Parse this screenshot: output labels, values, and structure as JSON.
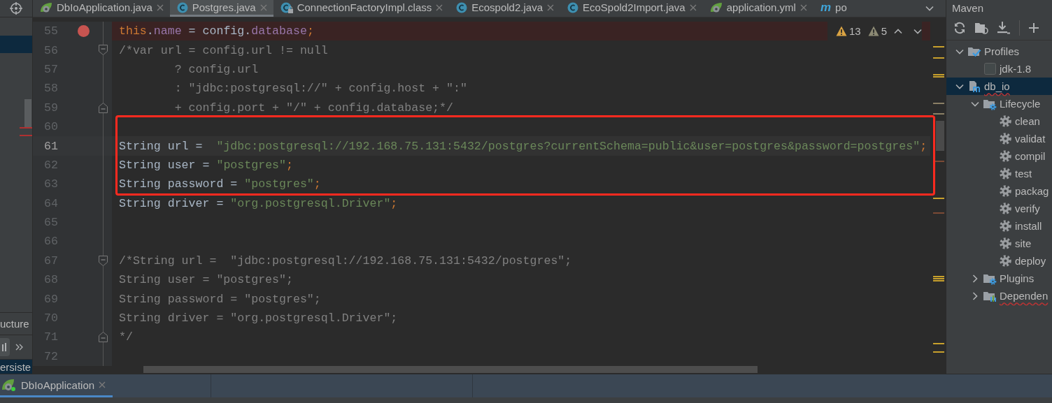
{
  "left_panel": {
    "tab": "ucture",
    "row": {
      "label": "ersiste",
      "selected": true
    }
  },
  "editor_tabs": [
    {
      "label": "DbIoApplication.java",
      "kind": "spring",
      "selected": false,
      "closable": true
    },
    {
      "label": "Postgres.java",
      "kind": "class",
      "selected": true,
      "closable": true
    },
    {
      "label": "ConnectionFactoryImpl.class",
      "kind": "locked_class",
      "selected": false,
      "closable": true
    },
    {
      "label": "Ecospold2.java",
      "kind": "class",
      "selected": false,
      "closable": true
    },
    {
      "label": "EcoSpold2Import.java",
      "kind": "class",
      "selected": false,
      "closable": true
    },
    {
      "label": "application.yml",
      "kind": "spring",
      "selected": false,
      "closable": true
    },
    {
      "label": "po",
      "kind": "letter",
      "glyph": "m",
      "selected": false,
      "closable": false
    }
  ],
  "inspections": [
    {
      "kind": "warning",
      "count": "13"
    },
    {
      "kind": "weak_warning",
      "count": "5"
    }
  ],
  "code_lines": [
    {
      "number": "55",
      "breakpoint": true,
      "current": false,
      "framed": false,
      "tokens": [
        {
          "kind": "keyword",
          "text": "this"
        },
        {
          "kind": "plain",
          "text": "."
        },
        {
          "kind": "field",
          "text": "name"
        },
        {
          "kind": "plain",
          "text": " = config."
        },
        {
          "kind": "field",
          "text": "database"
        },
        {
          "kind": "keyword",
          "text": ";"
        }
      ]
    },
    {
      "number": "56",
      "breakpoint": false,
      "current": false,
      "framed": false,
      "kind": "fold_start",
      "tokens": [
        {
          "kind": "comment",
          "text": "/*var url = config.url != null"
        }
      ]
    },
    {
      "number": "57",
      "breakpoint": false,
      "current": false,
      "framed": false,
      "tokens": [
        {
          "kind": "comment",
          "text": "        ? config.url"
        }
      ]
    },
    {
      "number": "58",
      "breakpoint": false,
      "current": false,
      "framed": false,
      "tokens": [
        {
          "kind": "comment",
          "text": "        : \"jdbc:postgresql://\" + config.host + \":\""
        }
      ]
    },
    {
      "number": "59",
      "breakpoint": false,
      "current": false,
      "framed": false,
      "kind": "fold_end",
      "tokens": [
        {
          "kind": "comment",
          "text": "        + config.port + \"/\" + config.database;*/"
        }
      ]
    },
    {
      "number": "60",
      "breakpoint": false,
      "current": false,
      "framed": true
    },
    {
      "number": "61",
      "breakpoint": false,
      "current": true,
      "framed": true,
      "tokens": [
        {
          "kind": "plain",
          "text": "String url =  "
        },
        {
          "kind": "string",
          "text": "\"jdbc:postgresql://192.168.75.131:5432/postgres?currentSchema=public&user=postgres&password=postgres\""
        },
        {
          "kind": "keyword",
          "text": ";"
        }
      ]
    },
    {
      "number": "62",
      "breakpoint": false,
      "current": false,
      "framed": true,
      "tokens": [
        {
          "kind": "plain",
          "text": "String user = "
        },
        {
          "kind": "string",
          "text": "\"postgres\""
        },
        {
          "kind": "keyword",
          "text": ";"
        }
      ]
    },
    {
      "number": "63",
      "breakpoint": false,
      "current": false,
      "framed": true,
      "tokens": [
        {
          "kind": "plain",
          "text": "String password = "
        },
        {
          "kind": "string",
          "text": "\"postgres\""
        },
        {
          "kind": "keyword",
          "text": ";"
        }
      ]
    },
    {
      "number": "64",
      "breakpoint": false,
      "current": false,
      "framed": false,
      "tokens": [
        {
          "kind": "plain",
          "text": "String driver = "
        },
        {
          "kind": "string",
          "text": "\"org.postgresql.Driver\""
        },
        {
          "kind": "keyword",
          "text": ";"
        }
      ]
    },
    {
      "number": "65",
      "breakpoint": false,
      "current": false,
      "framed": false
    },
    {
      "number": "66",
      "breakpoint": false,
      "current": false,
      "framed": false
    },
    {
      "number": "67",
      "breakpoint": false,
      "current": false,
      "framed": false,
      "kind": "fold_start",
      "tokens": [
        {
          "kind": "comment",
          "text": "/*String url =  \"jdbc:postgresql://192.168.75.131:5432/postgres\";"
        }
      ]
    },
    {
      "number": "68",
      "breakpoint": false,
      "current": false,
      "framed": false,
      "tokens": [
        {
          "kind": "comment",
          "text": "String user = \"postgres\";"
        }
      ]
    },
    {
      "number": "69",
      "breakpoint": false,
      "current": false,
      "framed": false,
      "tokens": [
        {
          "kind": "comment",
          "text": "String password = \"postgres\";"
        }
      ]
    },
    {
      "number": "70",
      "breakpoint": false,
      "current": false,
      "framed": false,
      "tokens": [
        {
          "kind": "comment",
          "text": "String driver = \"org.postgresql.Driver\";"
        }
      ]
    },
    {
      "number": "71",
      "breakpoint": false,
      "current": false,
      "framed": false,
      "kind": "fold_end",
      "tokens": [
        {
          "kind": "comment",
          "text": "*/"
        }
      ]
    },
    {
      "number": "72",
      "breakpoint": false,
      "current": false,
      "framed": false
    }
  ],
  "maven": {
    "title": "Maven",
    "tree": [
      {
        "label": "Profiles",
        "kind": "profiles",
        "expanded": true,
        "selected": false,
        "children": [
          {
            "label": "jdk-1.8",
            "kind": "checkbox",
            "checked": false,
            "selected": false
          }
        ]
      },
      {
        "label": "db_io",
        "kind": "module",
        "expanded": true,
        "selected": true,
        "children": [
          {
            "label": "Lifecycle",
            "kind": "folder_gear",
            "expanded": true,
            "selected": false,
            "children": [
              {
                "label": "clean",
                "kind": "goal",
                "selected": false
              },
              {
                "label": "validat",
                "kind": "goal",
                "selected": false
              },
              {
                "label": "compil",
                "kind": "goal",
                "selected": false
              },
              {
                "label": "test",
                "kind": "goal",
                "selected": false
              },
              {
                "label": "packag",
                "kind": "goal",
                "selected": false
              },
              {
                "label": "verify",
                "kind": "goal",
                "selected": false
              },
              {
                "label": "install",
                "kind": "goal",
                "selected": false
              },
              {
                "label": "site",
                "kind": "goal",
                "selected": false
              },
              {
                "label": "deploy",
                "kind": "goal",
                "selected": false
              }
            ]
          },
          {
            "label": "Plugins",
            "kind": "folder_gear",
            "expanded": false,
            "selected": false
          },
          {
            "label": "Dependen",
            "kind": "folder_chart",
            "expanded": false,
            "selected": false
          }
        ]
      }
    ]
  },
  "run_tabs": [
    {
      "label": "DbIoApplication",
      "selected": true
    }
  ]
}
